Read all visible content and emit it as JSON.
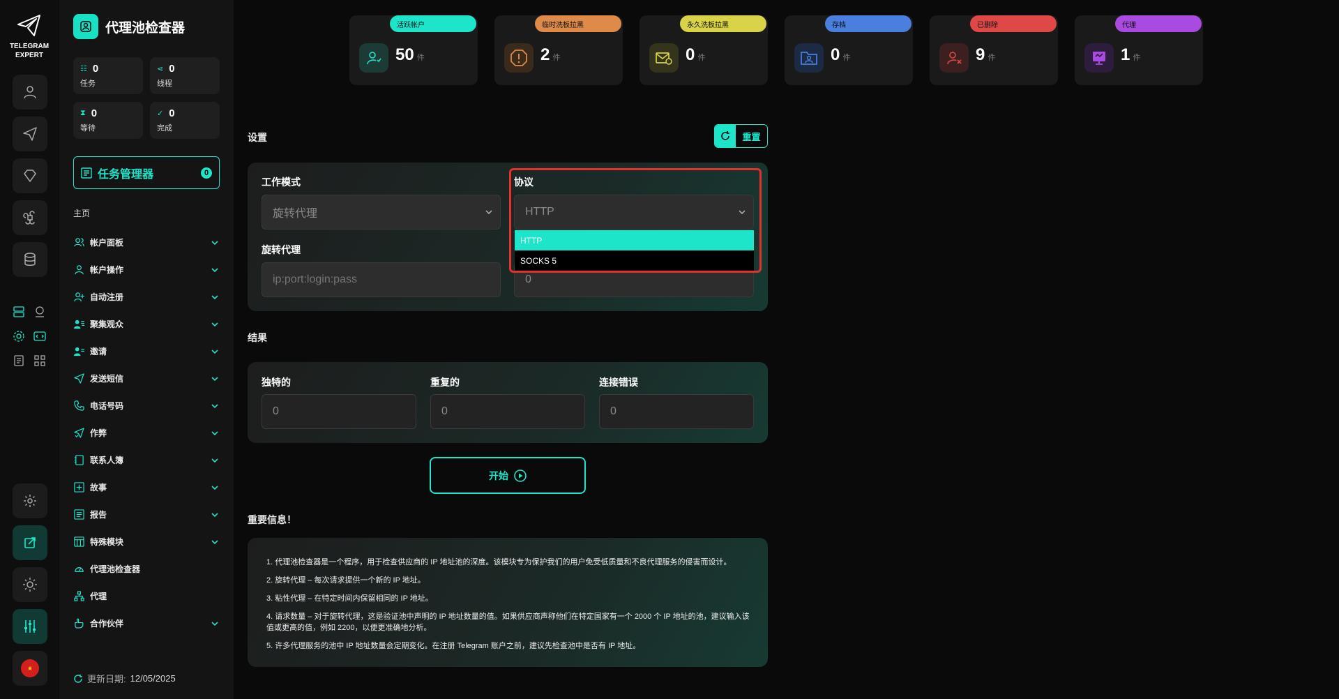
{
  "brand": {
    "logo_text_line1": "TELEGRAM",
    "logo_text_line2": "EXPERT",
    "title": "代理池检查器"
  },
  "sidebar": {
    "stats": [
      {
        "value": "0",
        "label": "任务"
      },
      {
        "value": "0",
        "label": "线程"
      },
      {
        "value": "0",
        "label": "等待"
      },
      {
        "value": "0",
        "label": "完成"
      }
    ],
    "task_manager": {
      "label": "任务管理器",
      "count": "0"
    },
    "home_label": "主页",
    "items": [
      {
        "label": "帐户面板",
        "icon": "users-icon",
        "chevron": true
      },
      {
        "label": "帐户操作",
        "icon": "user-icon",
        "chevron": true
      },
      {
        "label": "自动注册",
        "icon": "user-plus-icon",
        "chevron": true
      },
      {
        "label": "聚集观众",
        "icon": "user-list-icon",
        "chevron": true
      },
      {
        "label": "邀请",
        "icon": "invite-icon",
        "chevron": true
      },
      {
        "label": "发送短信",
        "icon": "send-icon",
        "chevron": true
      },
      {
        "label": "电话号码",
        "icon": "phone-icon",
        "chevron": true
      },
      {
        "label": "作弊",
        "icon": "send-check-icon",
        "chevron": true
      },
      {
        "label": "联系人簿",
        "icon": "contacts-icon",
        "chevron": true
      },
      {
        "label": "故事",
        "icon": "story-icon",
        "chevron": true
      },
      {
        "label": "报告",
        "icon": "report-icon",
        "chevron": true
      },
      {
        "label": "特殊模块",
        "icon": "module-icon",
        "chevron": true
      },
      {
        "label": "代理池检查器",
        "icon": "gauge-icon",
        "chevron": false
      },
      {
        "label": "代理",
        "icon": "network-icon",
        "chevron": false
      },
      {
        "label": "合作伙伴",
        "icon": "hand-icon",
        "chevron": true
      }
    ],
    "update_label": "更新日期:",
    "update_date": "12/05/2025"
  },
  "counters": [
    {
      "label": "活跃帐户",
      "value": "50",
      "unit": "件",
      "color": "#1de5c9"
    },
    {
      "label": "临时洗板拉黑",
      "value": "2",
      "unit": "件",
      "color": "#e08a4a"
    },
    {
      "label": "永久洗板拉黑",
      "value": "0",
      "unit": "件",
      "color": "#d9d347"
    },
    {
      "label": "存档",
      "value": "0",
      "unit": "件",
      "color": "#4a7fe0"
    },
    {
      "label": "已删除",
      "value": "9",
      "unit": "件",
      "color": "#e04848"
    },
    {
      "label": "代理",
      "value": "1",
      "unit": "件",
      "color": "#a94ae0"
    }
  ],
  "settings": {
    "title": "设置",
    "reset_label": "重置",
    "work_mode_label": "工作模式",
    "work_mode_value": "旋转代理",
    "protocol_label": "协议",
    "protocol_value": "HTTP",
    "protocol_options": [
      "HTTP",
      "SOCKS 5"
    ],
    "rotating_label": "旋转代理",
    "rotating_placeholder": "ip:port:login:pass",
    "request_count_value": "0"
  },
  "results": {
    "title": "结果",
    "unique_label": "独特的",
    "unique_value": "0",
    "duplicate_label": "重复的",
    "duplicate_value": "0",
    "error_label": "连接错误",
    "error_value": "0"
  },
  "start_label": "开始",
  "info": {
    "title": "重要信息！",
    "items": [
      "1. 代理池检查器是一个程序，用于检查供应商的 IP 地址池的深度。该模块专为保护我们的用户免受低质量和不良代理服务的侵害而设计。",
      "2. 旋转代理 – 每次请求提供一个新的 IP 地址。",
      "3. 粘性代理 – 在特定时间内保留相同的 IP 地址。",
      "4. 请求数量 – 对于旋转代理，这是验证池中声明的 IP 地址数量的值。如果供应商声称他们在特定国家有一个 2000 个 IP 地址的池，建议输入该值或更高的值，例如 2200，以便更准确地分析。",
      "5. 许多代理服务的池中 IP 地址数量会定期变化。在注册 Telegram 账户之前，建议先检查池中是否有 IP 地址。"
    ]
  },
  "accent_color": "#1de5c9",
  "highlight_color": "#e2312e"
}
